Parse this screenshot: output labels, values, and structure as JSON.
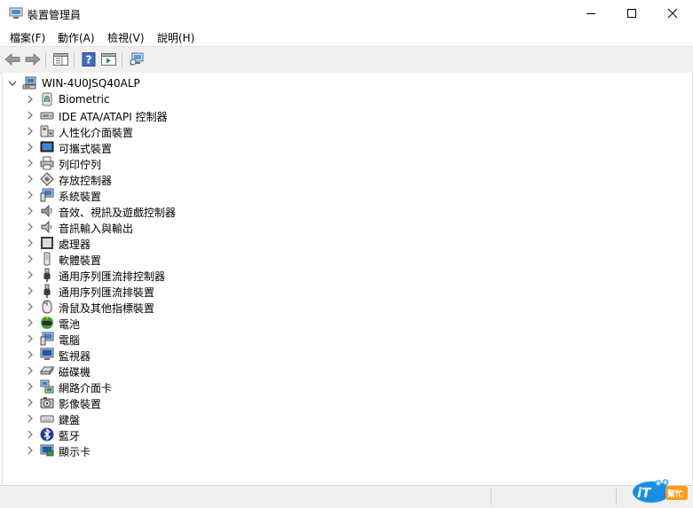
{
  "window": {
    "title": "裝置管理員",
    "controls": {
      "minimize": "minimize",
      "maximize": "maximize",
      "close": "close"
    }
  },
  "menubar": {
    "items": [
      {
        "label": "檔案(F)"
      },
      {
        "label": "動作(A)"
      },
      {
        "label": "檢視(V)"
      },
      {
        "label": "說明(H)"
      }
    ]
  },
  "toolbar": {
    "buttons": [
      "back-icon",
      "forward-icon",
      "properties-panel-icon",
      "help-icon",
      "run-icon",
      "scan-hardware-icon"
    ]
  },
  "tree": {
    "root": {
      "label": "WIN-4U0JSQ40ALP",
      "expanded": true
    },
    "items": [
      {
        "label": "Biometric",
        "icon": "biometric-icon"
      },
      {
        "label": "IDE ATA/ATAPI 控制器",
        "icon": "ide-controller-icon"
      },
      {
        "label": "人性化介面裝置",
        "icon": "hid-icon"
      },
      {
        "label": "可攜式裝置",
        "icon": "portable-device-icon"
      },
      {
        "label": "列印佇列",
        "icon": "printer-icon"
      },
      {
        "label": "存放控制器",
        "icon": "storage-controller-icon"
      },
      {
        "label": "系統裝置",
        "icon": "system-device-icon"
      },
      {
        "label": "音效、視訊及遊戲控制器",
        "icon": "sound-icon"
      },
      {
        "label": "音訊輸入與輸出",
        "icon": "audio-io-icon"
      },
      {
        "label": "處理器",
        "icon": "processor-icon"
      },
      {
        "label": "軟體裝置",
        "icon": "software-device-icon"
      },
      {
        "label": "通用序列匯流排控制器",
        "icon": "usb-controller-icon"
      },
      {
        "label": "通用序列匯流排裝置",
        "icon": "usb-device-icon"
      },
      {
        "label": "滑鼠及其他指標裝置",
        "icon": "mouse-icon"
      },
      {
        "label": "電池",
        "icon": "battery-icon"
      },
      {
        "label": "電腦",
        "icon": "computer-icon"
      },
      {
        "label": "監視器",
        "icon": "monitor-icon"
      },
      {
        "label": "磁碟機",
        "icon": "disk-drive-icon"
      },
      {
        "label": "網路介面卡",
        "icon": "network-adapter-icon"
      },
      {
        "label": "影像裝置",
        "icon": "imaging-device-icon"
      },
      {
        "label": "鍵盤",
        "icon": "keyboard-icon"
      },
      {
        "label": "藍牙",
        "icon": "bluetooth-icon"
      },
      {
        "label": "顯示卡",
        "icon": "display-adapter-icon"
      }
    ]
  },
  "watermark": {
    "text": "iT邦幫忙"
  }
}
